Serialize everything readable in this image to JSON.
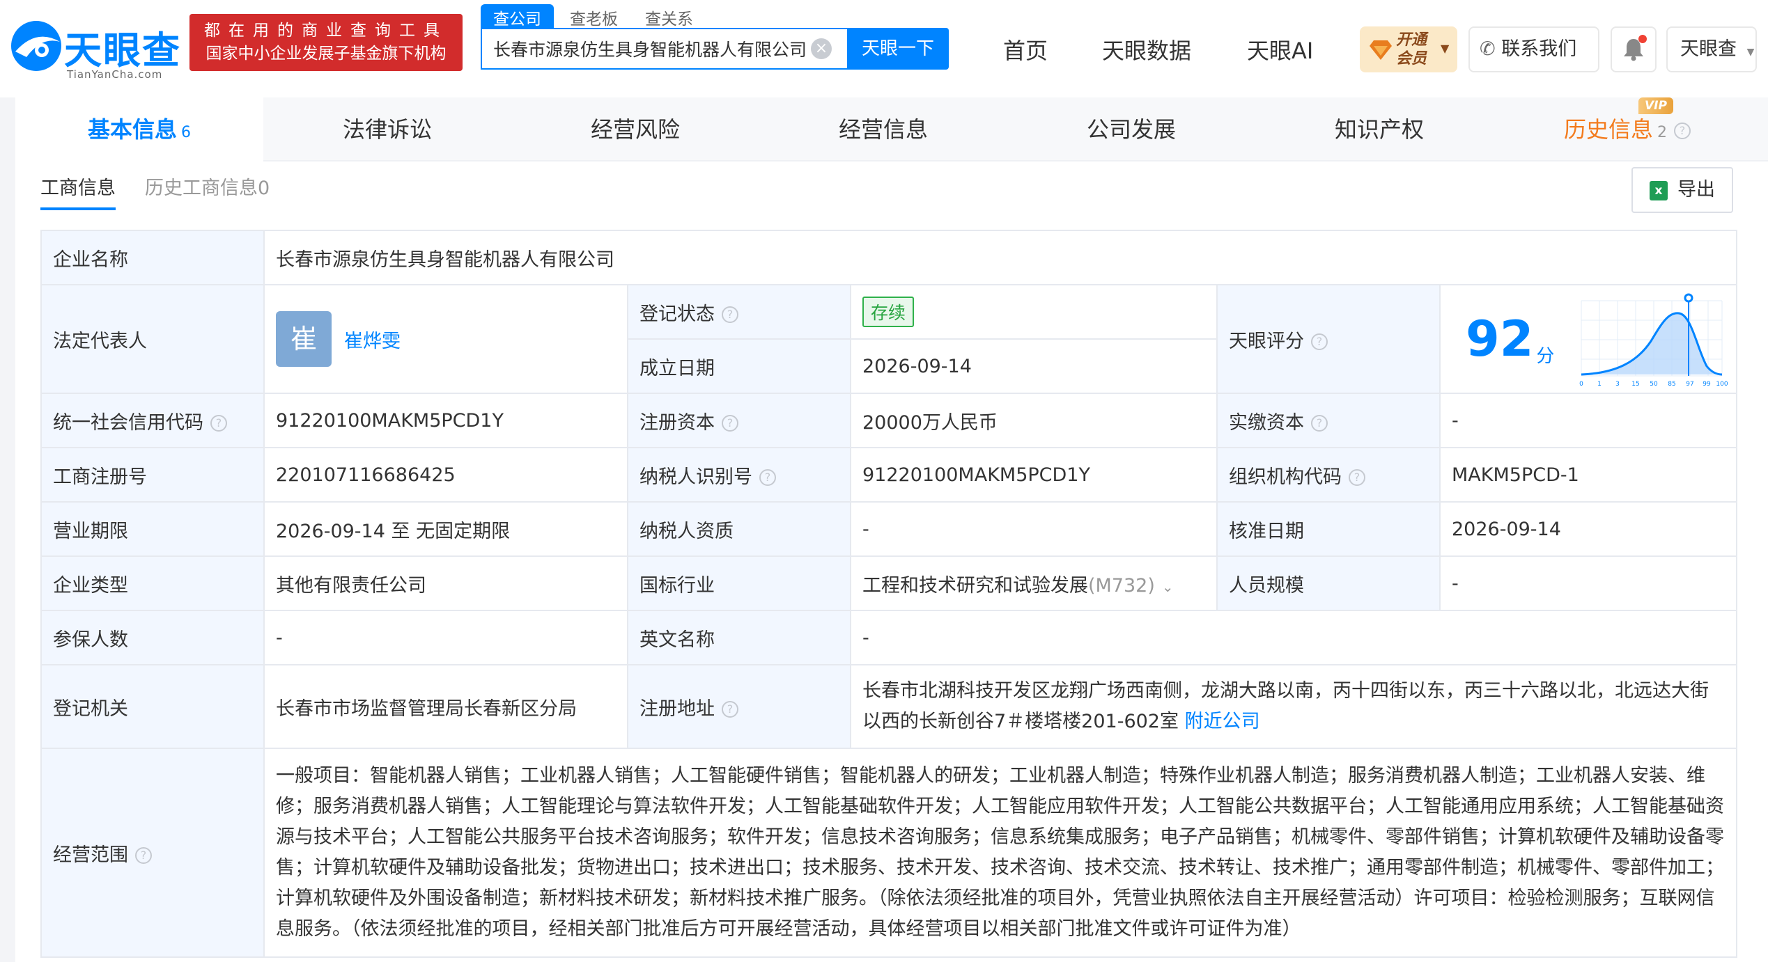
{
  "header": {
    "logo": {
      "name": "天眼查",
      "site": "TianYanCha.com"
    },
    "banner": {
      "line1": "都在用的商业查询工具",
      "line2": "国家中小企业发展子基金旗下机构"
    },
    "search_tabs": [
      "查公司",
      "查老板",
      "查关系"
    ],
    "search": {
      "value": "长春市源泉仿生具身智能机器人有限公司",
      "button": "天眼一下"
    },
    "nav": [
      "首页",
      "天眼数据",
      "天眼AI"
    ],
    "vip": {
      "line1": "开通",
      "line2": "会员"
    },
    "contact": "联系我们",
    "user": "天眼查"
  },
  "main_tabs": [
    {
      "label": "基本信息",
      "count": "6"
    },
    {
      "label": "法律诉讼",
      "count": ""
    },
    {
      "label": "经营风险",
      "count": ""
    },
    {
      "label": "经营信息",
      "count": ""
    },
    {
      "label": "公司发展",
      "count": ""
    },
    {
      "label": "知识产权",
      "count": ""
    },
    {
      "label": "历史信息",
      "count": "2",
      "tag": "VIP"
    }
  ],
  "sub_tabs": [
    "工商信息",
    "历史工商信息0"
  ],
  "export_label": "导出",
  "company": {
    "name_label": "企业名称",
    "name": "长春市源泉仿生具身智能机器人有限公司",
    "legal_rep_label": "法定代表人",
    "legal_rep_avatar": "崔",
    "legal_rep": "崔烨雯",
    "status_label": "登记状态",
    "status": "存续",
    "established_label": "成立日期",
    "established": "2026-09-14",
    "score_label": "天眼评分",
    "score": "92",
    "score_unit": "分",
    "score_axis": [
      "0",
      "1",
      "3",
      "15",
      "50",
      "85",
      "97",
      "99",
      "100"
    ],
    "credit_code_label": "统一社会信用代码",
    "credit_code": "91220100MAKM5PCD1Y",
    "reg_capital_label": "注册资本",
    "reg_capital": "20000万人民币",
    "paid_capital_label": "实缴资本",
    "paid_capital": "-",
    "reg_no_label": "工商注册号",
    "reg_no": "220107116686425",
    "taxpayer_id_label": "纳税人识别号",
    "taxpayer_id": "91220100MAKM5PCD1Y",
    "org_code_label": "组织机构代码",
    "org_code": "MAKM5PCD-1",
    "term_label": "营业期限",
    "term": "2026-09-14 至 无固定期限",
    "taxpayer_qual_label": "纳税人资质",
    "taxpayer_qual": "-",
    "approval_date_label": "核准日期",
    "approval_date": "2026-09-14",
    "type_label": "企业类型",
    "type": "其他有限责任公司",
    "industry_label": "国标行业",
    "industry": "工程和技术研究和试验发展",
    "industry_code": "(M732)",
    "staff_label": "人员规模",
    "staff": "-",
    "insured_label": "参保人数",
    "insured": "-",
    "english_name_label": "英文名称",
    "english_name": "-",
    "authority_label": "登记机关",
    "authority": "长春市市场监督管理局长春新区分局",
    "address_label": "注册地址",
    "address": "长春市北湖科技开发区龙翔广场西南侧，龙湖大路以南，丙十四街以东，丙三十六路以北，北远达大街以西的长新创谷7＃楼塔楼201-602室",
    "nearby_link": "附近公司",
    "scope_label": "经营范围",
    "scope": "一般项目：智能机器人销售；工业机器人销售；人工智能硬件销售；智能机器人的研发；工业机器人制造；特殊作业机器人制造；服务消费机器人制造；工业机器人安装、维修；服务消费机器人销售；人工智能理论与算法软件开发；人工智能基础软件开发；人工智能应用软件开发；人工智能公共数据平台；人工智能通用应用系统；人工智能基础资源与技术平台；人工智能公共服务平台技术咨询服务；软件开发；信息技术咨询服务；信息系统集成服务；电子产品销售；机械零件、零部件销售；计算机软硬件及辅助设备零售；计算机软硬件及辅助设备批发；货物进出口；技术进出口；技术服务、技术开发、技术咨询、技术交流、技术转让、技术推广；通用零部件制造；机械零件、零部件加工；计算机软硬件及外围设备制造；新材料技术研发；新材料技术推广服务。（除依法须经批准的项目外，凭营业执照依法自主开展经营活动）许可项目：检验检测服务；互联网信息服务。（依法须经批准的项目，经相关部门批准后方可开展经营活动，具体经营项目以相关部门批准文件或许可证件为准）"
  },
  "colors": {
    "brand": "#0084ff",
    "banner": "#d22c2c",
    "status": "#27a43f",
    "history": "#f37b1d",
    "label_bg": "#f2f7ff"
  }
}
